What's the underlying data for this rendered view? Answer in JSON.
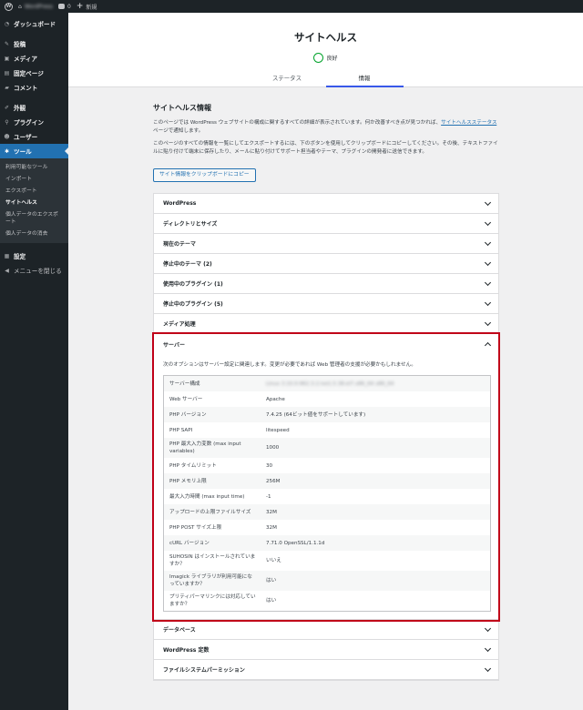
{
  "admin_bar": {
    "site_name": "WordPress",
    "comments_count": "0",
    "new_label": "新規"
  },
  "sidebar": {
    "items_top": [
      {
        "label": "ダッシュボード",
        "icon": "dashboard-icon"
      },
      {
        "label": "投稿",
        "icon": "pin-icon"
      },
      {
        "label": "メディア",
        "icon": "media-icon"
      },
      {
        "label": "固定ページ",
        "icon": "page-icon"
      },
      {
        "label": "コメント",
        "icon": "comment-icon"
      }
    ],
    "items_mid": [
      {
        "label": "外観",
        "icon": "brush-icon"
      },
      {
        "label": "プラグイン",
        "icon": "plugin-icon"
      },
      {
        "label": "ユーザー",
        "icon": "user-icon"
      },
      {
        "label": "ツール",
        "icon": "wrench-icon"
      }
    ],
    "submenu": [
      "利用可能なツール",
      "インポート",
      "エクスポート",
      "サイトヘルス",
      "個人データのエクスポート",
      "個人データの消去"
    ],
    "items_bottom": [
      {
        "label": "設定",
        "icon": "settings-icon"
      },
      {
        "label": "メニューを閉じる",
        "icon": "collapse-icon"
      }
    ]
  },
  "header": {
    "title": "サイトヘルス",
    "status": "良好",
    "tabs": [
      "ステータス",
      "情報"
    ]
  },
  "main": {
    "section_title": "サイトヘルス情報",
    "desc1_a": "このページでは WordPress ウェブサイトの構成に関するすべての詳細が表示されています。何か改善すべき点が見つかれば、",
    "desc1_link": "サイトヘルスステータス",
    "desc1_b": "ページで通知します。",
    "desc2": "このページのすべての情報を一覧にしてエクスポートするには、下のボタンを使用してクリップボードにコピーしてください。その後、テキストファイルに貼り付けて端末に保存したり、メールに貼り付けてサポート担当者やテーマ、プラグインの開発者に送信できます。",
    "copy_button": "サイト情報をクリップボードにコピー"
  },
  "sections_before": [
    "WordPress",
    "ディレクトリとサイズ",
    "現在のテーマ",
    "停止中のテーマ (2)",
    "使用中のプラグイン (1)",
    "停止中のプラグイン (5)",
    "メディア処理"
  ],
  "server": {
    "title": "サーバー",
    "intro": "次のオプションはサーバー設定に関連します。変更が必要であれば Web 管理者の支援が必要かもしれません。",
    "rows": [
      {
        "k": "サーバー構成",
        "v": "Linux 3.10.0-962.3.2.lve1.5.38.el7.x86_64 x86_64"
      },
      {
        "k": "Web サーバー",
        "v": "Apache"
      },
      {
        "k": "PHP バージョン",
        "v": "7.4.25 (64ビット値をサポートしています)"
      },
      {
        "k": "PHP SAPI",
        "v": "litespeed"
      },
      {
        "k": "PHP 最大入力変数 (max input variables)",
        "v": "1000"
      },
      {
        "k": "PHP タイムリミット",
        "v": "30"
      },
      {
        "k": "PHP メモリ上限",
        "v": "256M"
      },
      {
        "k": "最大入力時間 (max input time)",
        "v": "-1"
      },
      {
        "k": "アップロードの上限ファイルサイズ",
        "v": "32M"
      },
      {
        "k": "PHP POST サイズ上限",
        "v": "32M"
      },
      {
        "k": "cURL バージョン",
        "v": "7.71.0 OpenSSL/1.1.1d"
      },
      {
        "k": "SUHOSIN はインストールされていますか？",
        "v": "いいえ"
      },
      {
        "k": "Imagick ライブラリが利用可能になっていますか？",
        "v": "はい"
      },
      {
        "k": "プリティパーマリンクには対応していますか？",
        "v": "はい"
      }
    ]
  },
  "sections_after": [
    "データベース",
    "WordPress 定数",
    "ファイルシステムパーミッション"
  ],
  "colors": {
    "accent": "#2271b1",
    "highlight": "#c00018",
    "good": "#00a32a",
    "tab_active": "#3858e9"
  }
}
